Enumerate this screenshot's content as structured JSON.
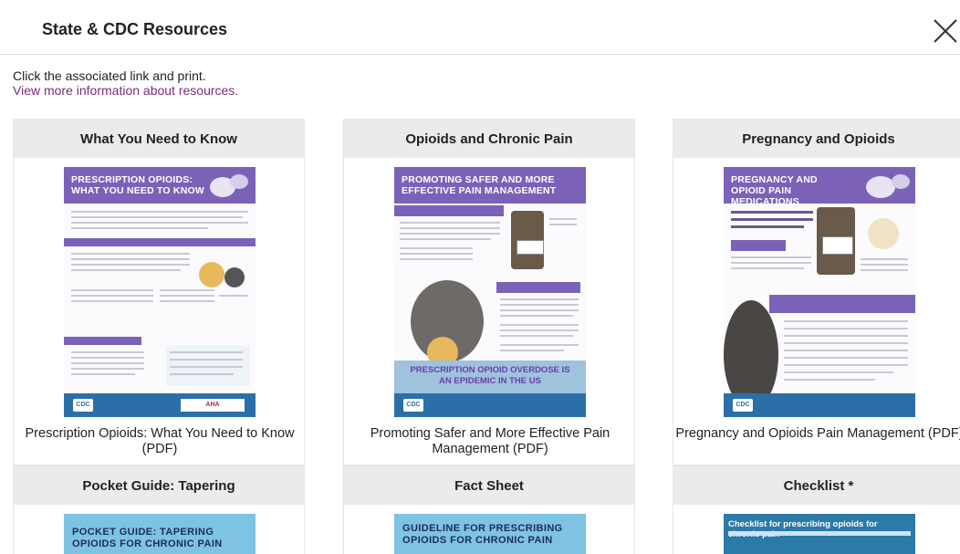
{
  "modal": {
    "title": "State & CDC Resources",
    "close_icon": "close-icon"
  },
  "intro": {
    "text": "Click the associated link and print.",
    "link": "View more information about resources."
  },
  "cards": [
    {
      "heading": "What You Need to Know",
      "poster_title": "PRESCRIPTION OPIOIDS: WHAT YOU NEED TO KNOW",
      "caption": "Prescription Opioids: What You Need to Know (PDF)"
    },
    {
      "heading": "Opioids and Chronic Pain",
      "poster_title": "PROMOTING SAFER AND MORE EFFECTIVE PAIN MANAGEMENT",
      "poster_callout": "PRESCRIPTION OPIOID OVERDOSE IS AN EPIDEMIC IN THE US",
      "caption": "Promoting Safer and More Effective Pain Management (PDF)"
    },
    {
      "heading": "Pregnancy and Opioids",
      "poster_title": "PREGNANCY AND OPIOID PAIN MEDICATIONS",
      "caption": "Pregnancy and Opioids Pain Management (PDF)"
    },
    {
      "heading": "Pocket Guide: Tapering",
      "poster_title": "POCKET GUIDE: TAPERING OPIOIDS FOR CHRONIC PAIN"
    },
    {
      "heading": "Fact Sheet",
      "poster_title": "GUIDELINE FOR PRESCRIBING OPIOIDS FOR CHRONIC PAIN"
    },
    {
      "heading": "Checklist *",
      "poster_title": "Checklist for prescribing opioids for chronic pain"
    }
  ],
  "colors": {
    "poster_purple": "#7b62b8",
    "poster_blue": "#2b6fa8",
    "link_purple": "#7a2a7a",
    "card_header_gray": "#ebebeb"
  }
}
